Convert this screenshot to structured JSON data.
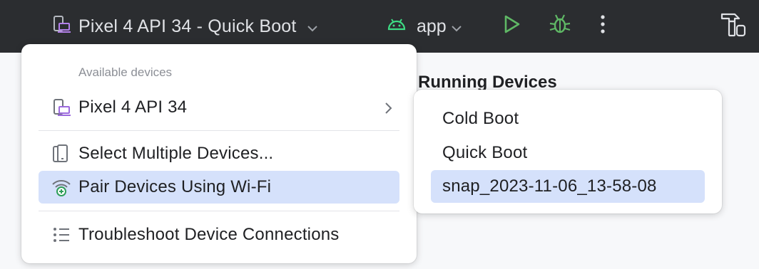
{
  "toolbar": {
    "device_selector_label": "Pixel 4 API 34 - Quick Boot",
    "device_icon": "device-icon",
    "run_config_label": "app",
    "run_config_icon": "android-icon",
    "run_icon": "run-icon",
    "debug_icon": "debug-icon",
    "more_icon": "more-vertical-icon",
    "right_icon": "build-hammer-icon"
  },
  "background": {
    "panel_title": "Running Devices"
  },
  "device_menu": {
    "section_header": "Available devices",
    "items": [
      {
        "label": "Pixel 4 API 34",
        "icon": "device-icon",
        "has_submenu": true
      },
      {
        "label": "Select Multiple Devices...",
        "icon": "multiple-devices-icon"
      },
      {
        "label": "Pair Devices Using Wi-Fi",
        "icon": "wifi-pair-icon",
        "selected": true
      },
      {
        "label": "Troubleshoot Device Connections",
        "icon": "troubleshoot-list-icon"
      }
    ]
  },
  "boot_submenu": {
    "items": [
      {
        "label": "Cold Boot"
      },
      {
        "label": "Quick Boot"
      },
      {
        "label": "snap_2023-11-06_13-58-08",
        "selected": true
      }
    ]
  },
  "colors": {
    "toolbar_bg": "#2b2d30",
    "toolbar_text": "#dfe1e5",
    "selection": "#d5e1fb",
    "run_green": "#5fb865",
    "android_green": "#3ddc84",
    "device_purple": "#9c6ade"
  }
}
